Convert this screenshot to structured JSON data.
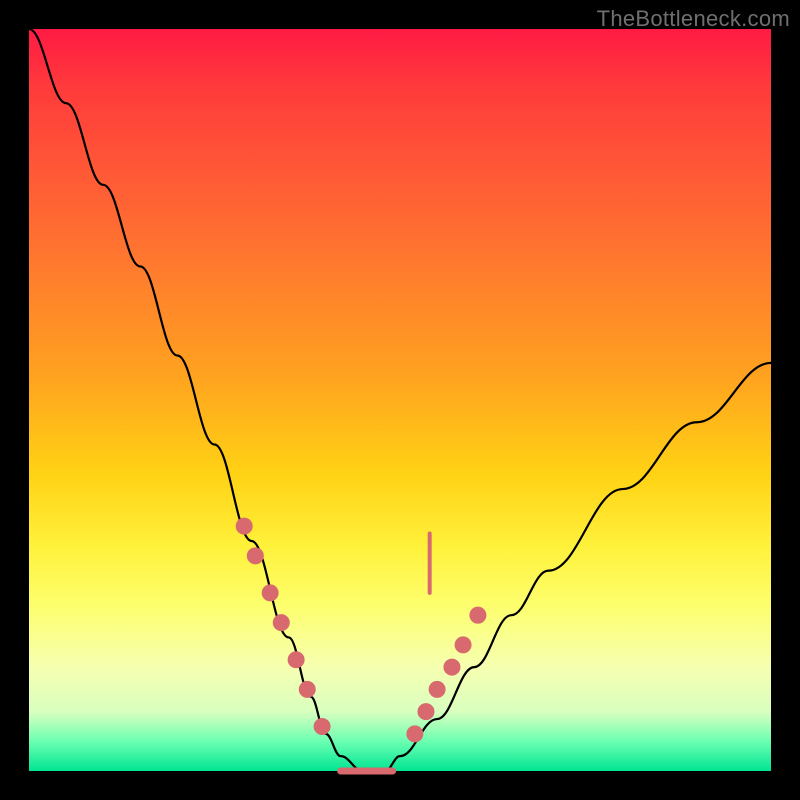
{
  "watermark": "TheBottleneck.com",
  "chart_data": {
    "type": "line",
    "title": "",
    "xlabel": "",
    "ylabel": "",
    "xlim": [
      0,
      100
    ],
    "ylim": [
      0,
      100
    ],
    "grid": false,
    "legend": false,
    "series": [
      {
        "name": "bottleneck-curve",
        "x": [
          0,
          5,
          10,
          15,
          20,
          25,
          30,
          35,
          38,
          40,
          42,
          45,
          48,
          50,
          55,
          60,
          65,
          70,
          80,
          90,
          100
        ],
        "y": [
          100,
          90,
          79,
          68,
          56,
          44,
          31,
          18,
          10,
          5,
          2,
          0,
          0,
          2,
          7,
          14,
          21,
          27,
          38,
          47,
          55
        ]
      }
    ],
    "markers_left": [
      {
        "x": 29.0,
        "y": 33
      },
      {
        "x": 30.5,
        "y": 29
      },
      {
        "x": 32.5,
        "y": 24
      },
      {
        "x": 34.0,
        "y": 20
      },
      {
        "x": 36.0,
        "y": 15
      },
      {
        "x": 37.5,
        "y": 11
      },
      {
        "x": 39.5,
        "y": 6
      }
    ],
    "markers_right": [
      {
        "x": 52.0,
        "y": 5
      },
      {
        "x": 53.5,
        "y": 8
      },
      {
        "x": 55.0,
        "y": 11
      },
      {
        "x": 57.0,
        "y": 14
      },
      {
        "x": 58.5,
        "y": 17
      },
      {
        "x": 60.5,
        "y": 21
      }
    ],
    "flat_bottom": {
      "x_start": 42,
      "x_end": 49,
      "y": 0
    },
    "extra_tick": {
      "x": 54,
      "y_start": 24,
      "y_end": 32
    },
    "colors": {
      "curve": "#000000",
      "markers": "#d86a6f",
      "gradient_top": "#ff1a44",
      "gradient_bottom": "#00e592",
      "frame": "#000000"
    }
  }
}
